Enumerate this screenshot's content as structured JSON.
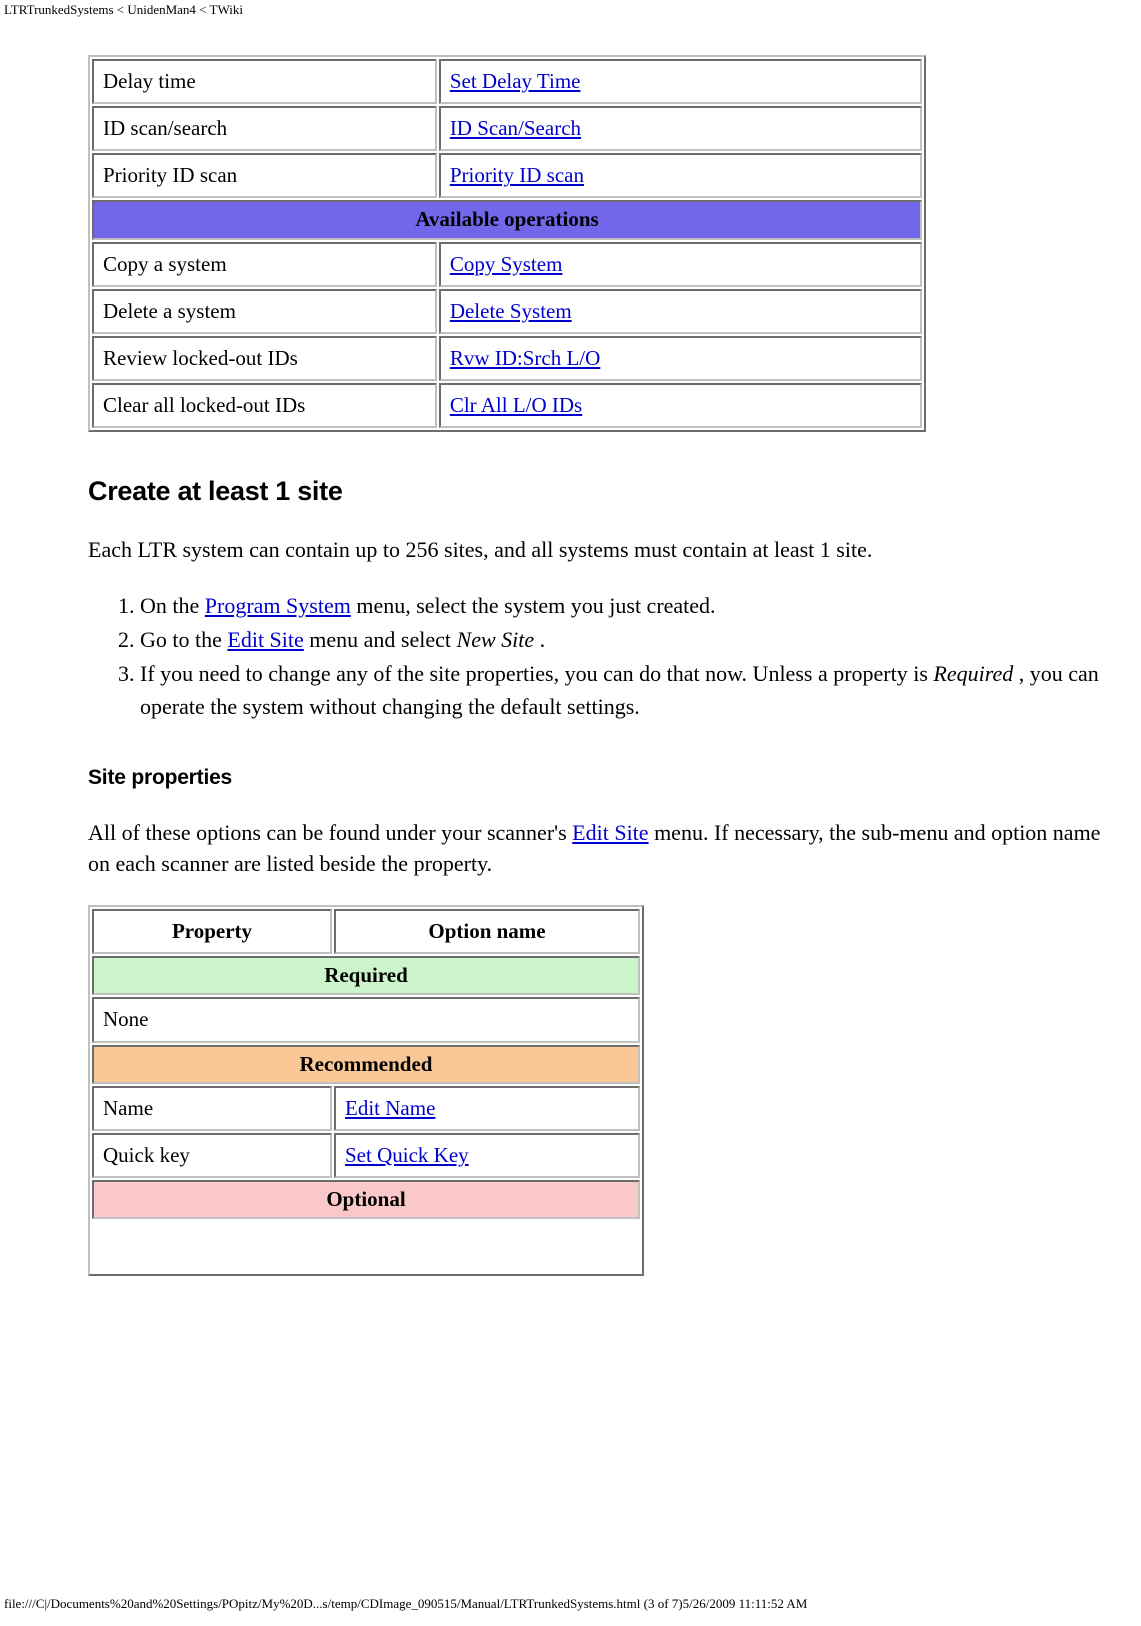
{
  "page": {
    "header": "LTRTrunkedSystems < UnidenMan4 < TWiki",
    "footer": "file:///C|/Documents%20and%20Settings/POpitz/My%20D...s/temp/CDImage_090515/Manual/LTRTrunkedSystems.html (3 of 7)5/26/2009 11:11:52 AM"
  },
  "colors": {
    "section_purple": "#7266ea",
    "required_green": "#ccf5cc",
    "recommended_orange": "#fac896",
    "optional_pink": "#fac8c8",
    "link_blue": "#0000cc",
    "table_border": "#c0c0c0"
  },
  "tables": {
    "operations": {
      "rows_top": [
        {
          "property": "Delay time",
          "option": "Set Delay Time"
        },
        {
          "property": "ID scan/search",
          "option": "ID Scan/Search"
        },
        {
          "property": "Priority ID scan",
          "option": "Priority ID scan"
        }
      ],
      "section_label": "Available operations",
      "rows_bottom": [
        {
          "property": "Copy a system",
          "option": "Copy System"
        },
        {
          "property": "Delete a system",
          "option": "Delete System"
        },
        {
          "property": "Review locked-out IDs",
          "option": "Rvw ID:Srch L/O"
        },
        {
          "property": "Clear all locked-out IDs",
          "option": "Clr All L/O IDs"
        }
      ]
    },
    "site_properties": {
      "headers": {
        "property": "Property",
        "option": "Option name"
      },
      "required_label": "Required",
      "required_rows": [
        {
          "property": "None"
        }
      ],
      "recommended_label": "Recommended",
      "recommended_rows": [
        {
          "property": "Name",
          "option": "Edit Name"
        },
        {
          "property": "Quick key",
          "option": "Set Quick Key"
        }
      ],
      "optional_label": "Optional"
    }
  },
  "sections": {
    "create_site": {
      "heading": "Create at least 1 site",
      "intro": "Each LTR system can contain up to 256 sites, and all systems must contain at least 1 site.",
      "steps": [
        {
          "pre": "On the ",
          "link": "Program System",
          "post": " menu, select the system you just created.",
          "italic": "",
          "tail": ""
        },
        {
          "pre": "Go to the ",
          "link": "Edit Site",
          "post": " menu and select ",
          "italic": "New Site",
          "tail": " ."
        },
        {
          "pre": "If you need to change any of the site properties, you can do that now. Unless a property is ",
          "link": "",
          "post": "",
          "italic": "Required",
          "tail": " , you can operate the system without changing the default settings."
        }
      ]
    },
    "site_properties": {
      "heading": "Site properties",
      "para_pre": "All of these options can be found under your scanner's ",
      "para_link": "Edit Site",
      "para_post": " menu. If necessary, the sub-menu and option name on each scanner are listed beside the property."
    }
  }
}
